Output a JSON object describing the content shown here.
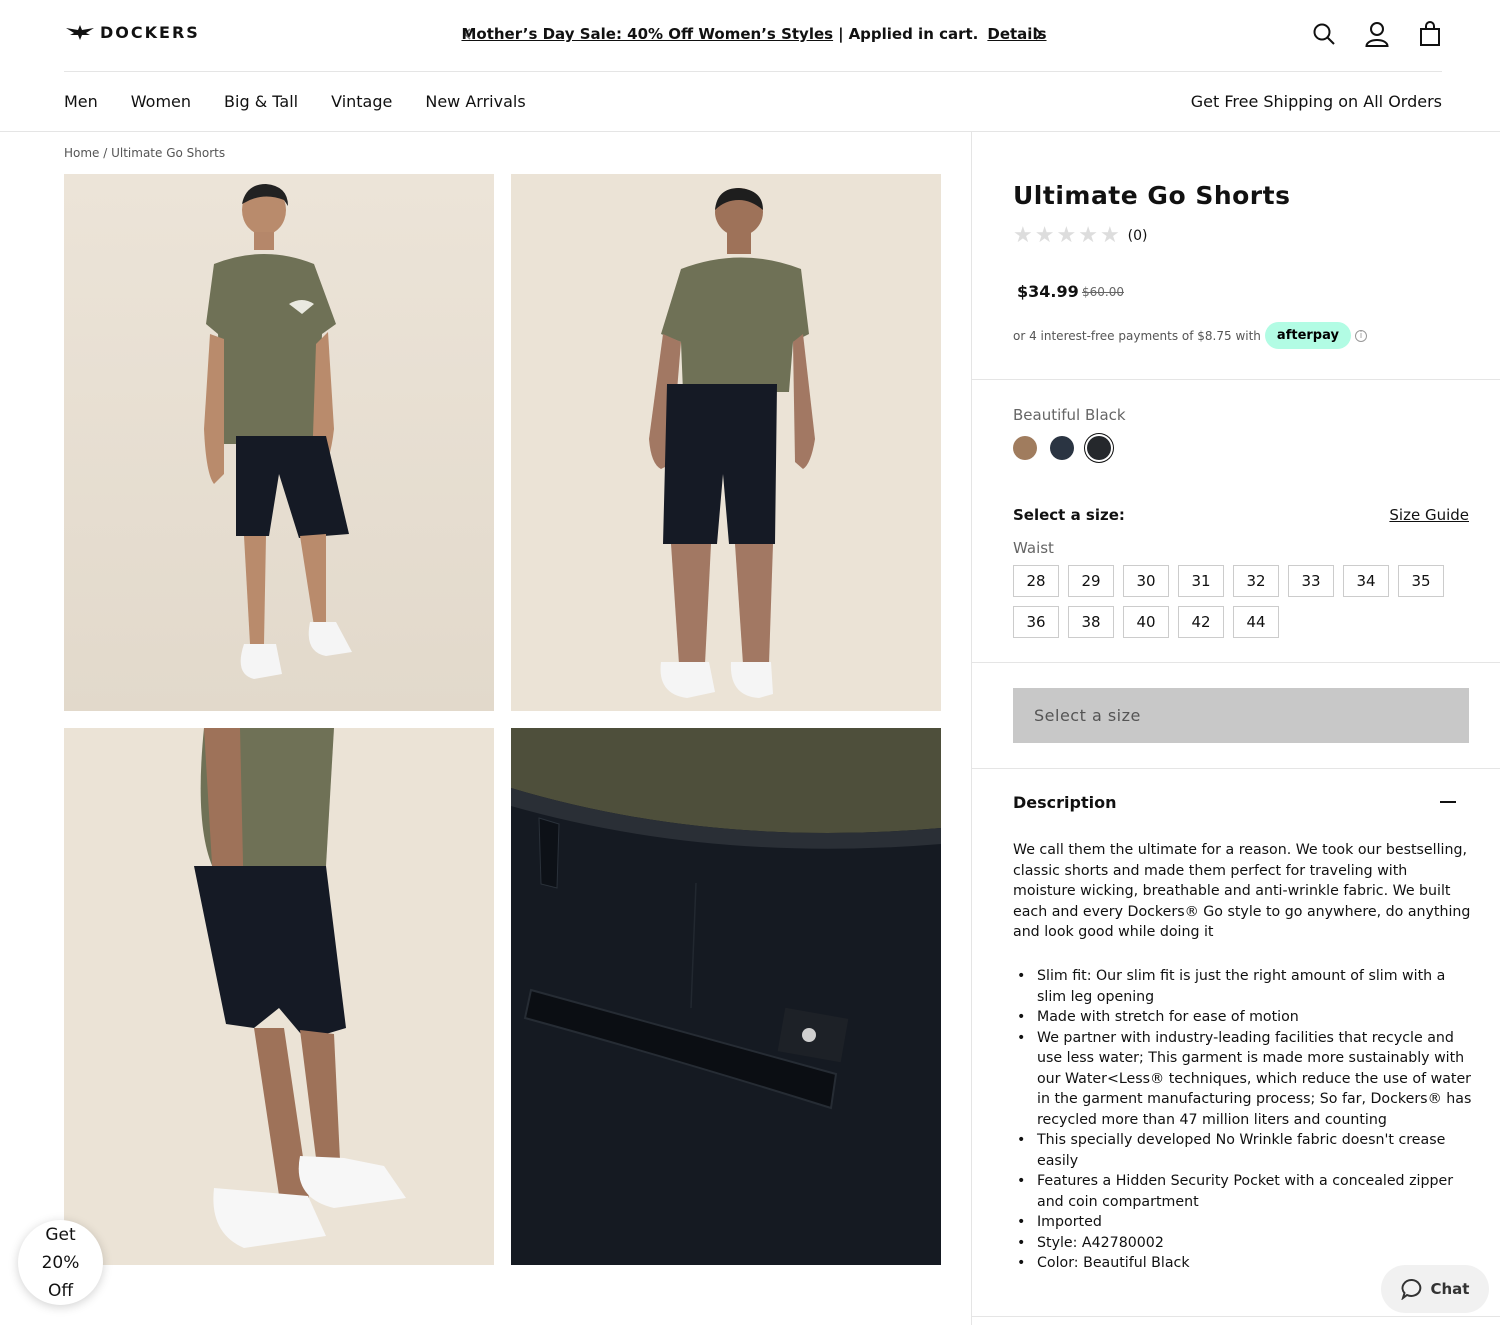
{
  "brand": {
    "name": "DOCKERS"
  },
  "promo": {
    "sale_text": "Mother’s Day Sale: 40% Off Women’s Styles",
    "separator": "|",
    "applied_text": "Applied in cart.",
    "details_label": "Details"
  },
  "nav": {
    "items": [
      "Men",
      "Women",
      "Big & Tall",
      "Vintage",
      "New Arrivals"
    ],
    "shipping": "Get Free Shipping on All Orders"
  },
  "breadcrumb": "Home / Ultimate Go Shorts",
  "product": {
    "title": "Ultimate Go Shorts",
    "rating_count": "(0)",
    "price": "$34.99",
    "was_price": "$60.00",
    "afterpay_text": "or 4 interest-free payments of $8.75 with",
    "afterpay_badge": "afterpay",
    "color_name": "Beautiful Black",
    "swatches": [
      "#a07c5e",
      "#2a3442",
      "#25282c"
    ],
    "size_label": "Select a size:",
    "size_guide": "Size Guide",
    "waist_label": "Waist",
    "sizes": [
      "28",
      "29",
      "30",
      "31",
      "32",
      "33",
      "34",
      "35",
      "36",
      "38",
      "40",
      "42",
      "44"
    ],
    "cta": "Select a size",
    "description_title": "Description",
    "description": "We call them the ultimate for a reason. We took our bestselling, classic shorts and made them perfect for traveling with moisture wicking, breathable and anti-wrinkle fabric. We built each and every Dockers® Go style to go anywhere, do anything and look good while doing it",
    "bullets": [
      "Slim fit: Our slim fit is just the right amount of slim with a slim leg opening",
      "Made with stretch for ease of motion",
      "We partner with industry-leading facilities that recycle and use less water; This garment is made more sustainably with our Water<Less® techniques, which reduce the use of water in the garment manufacturing process; So far, Dockers® has recycled more than 47 million liters and counting",
      "This specially developed No Wrinkle fabric doesn't crease easily",
      "Features a Hidden Security Pocket with a concealed zipper and coin compartment",
      "Imported",
      "Style: A42780002",
      "Color: Beautiful Black"
    ]
  },
  "float_promo": {
    "line1": "Get",
    "line2": "20%",
    "line3": "Off"
  },
  "chat": {
    "label": "Chat"
  },
  "colors": {
    "tee": "#6f7156",
    "shorts": "#151a25",
    "backdrop": "#ebe3d6",
    "afterpay": "#b2fce4"
  }
}
